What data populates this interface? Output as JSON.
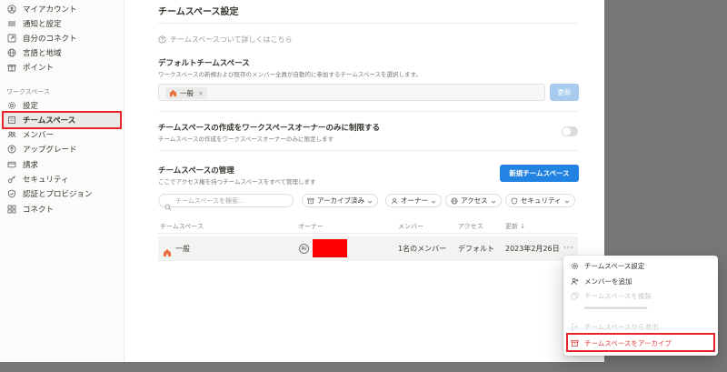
{
  "sidebar": {
    "top_items": [
      {
        "label": "マイアカウント",
        "icon": "user-circle-icon"
      },
      {
        "label": "通知と設定",
        "icon": "settings-lines-icon"
      },
      {
        "label": "自分のコネクト",
        "icon": "external-link-icon"
      },
      {
        "label": "言語と地域",
        "icon": "globe-icon"
      },
      {
        "label": "ポイント",
        "icon": "gift-icon"
      }
    ],
    "section_label": "ワークスペース",
    "workspace_items": [
      {
        "label": "設定",
        "icon": "gear-icon"
      },
      {
        "label": "チームスペース",
        "icon": "building-icon"
      },
      {
        "label": "メンバー",
        "icon": "people-icon"
      },
      {
        "label": "アップグレード",
        "icon": "arrow-up-circle-icon"
      },
      {
        "label": "請求",
        "icon": "credit-card-icon"
      },
      {
        "label": "セキュリティ",
        "icon": "key-icon"
      },
      {
        "label": "認証とプロビジョン",
        "icon": "shield-icon"
      },
      {
        "label": "コネクト",
        "icon": "grid-icon"
      }
    ]
  },
  "main": {
    "title": "チームスペース設定",
    "help_link": "チームスペースついて詳しくはこちら",
    "default_section": {
      "title": "デフォルトチームスペース",
      "description": "ワークスペースの新規および既存のメンバー全員が自動的に参加するチームスペースを選択します。",
      "chip_label": "一般",
      "chip_remove": "×",
      "update_button": "更新"
    },
    "restrict_section": {
      "title": "チームスペースの作成をワークスペースオーナーのみに制限する",
      "description": "チームスペースの作成をワークスペースオーナーのみに限定します",
      "toggle_on": false
    },
    "manage_section": {
      "title": "チームスペースの管理",
      "description": "ここでアクセス権を持つチームスペースをすべて管理します",
      "new_button": "新規チームスペース",
      "search_placeholder": "チームスペースを検索...",
      "filters": [
        {
          "label": "アーカイブ済み",
          "icon": "archive-icon"
        },
        {
          "label": "オーナー",
          "icon": "person-icon"
        },
        {
          "label": "アクセス",
          "icon": "globe-icon"
        },
        {
          "label": "セキュリティ",
          "icon": "shield-icon"
        }
      ]
    },
    "table": {
      "headers": [
        "チームスペース",
        "オーナー",
        "メンバー",
        "アクセス",
        "更新 ↓"
      ],
      "rows": [
        {
          "name": "一般",
          "owner_initial": "Ri",
          "members": "1名のメンバー",
          "access": "デフォルト",
          "updated": "2023年2月26日",
          "more": "···"
        }
      ]
    }
  },
  "context_menu": {
    "items": [
      {
        "label": "チームスペース設定",
        "icon": "gear-icon",
        "enabled": true
      },
      {
        "label": "メンバーを追加",
        "icon": "add-person-icon",
        "enabled": true
      },
      {
        "label": "チームスペースを複製",
        "icon": "copy-icon",
        "enabled": false
      },
      {
        "label": "チームスペースから退出",
        "icon": "exit-icon",
        "enabled": false
      },
      {
        "label": "チームスペースをアーカイブ",
        "icon": "archive-icon",
        "enabled": true,
        "danger": true
      }
    ]
  },
  "colors": {
    "accent": "#2383e2",
    "accent_disabled": "#a7cbee",
    "danger": "#e03e3e",
    "highlight": "#e3242b",
    "redaction": "#ff0000"
  }
}
